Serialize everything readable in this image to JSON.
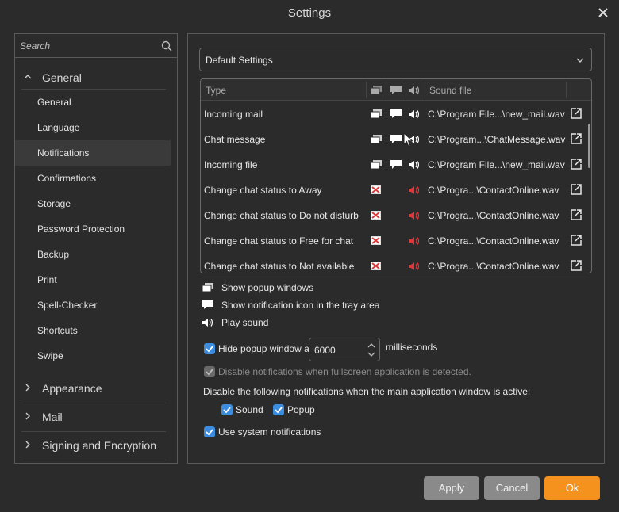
{
  "window": {
    "title": "Settings"
  },
  "search": {
    "placeholder": "Search"
  },
  "sidebar": {
    "general_group": "General",
    "items": [
      "General",
      "Language",
      "Notifications",
      "Confirmations",
      "Storage",
      "Password Protection",
      "Backup",
      "Print",
      "Spell-Checker",
      "Shortcuts",
      "Swipe"
    ],
    "active_item": "Notifications",
    "other_groups": [
      "Appearance",
      "Mail",
      "Signing and Encryption"
    ]
  },
  "profile": {
    "selected": "Default Settings"
  },
  "table": {
    "headers": {
      "type": "Type",
      "sound_file": "Sound file"
    },
    "rows": [
      {
        "type": "Incoming mail",
        "file": "C:\\Program File...\\new_mail.wav",
        "enabled": true
      },
      {
        "type": "Chat message",
        "file": "C:\\Program...\\ChatMessage.wav",
        "enabled": true
      },
      {
        "type": "Incoming file",
        "file": "C:\\Program File...\\new_mail.wav",
        "enabled": true
      },
      {
        "type": "Change chat status to Away",
        "file": "C:\\Progra...\\ContactOnline.wav",
        "enabled": false
      },
      {
        "type": "Change chat status to Do not disturb",
        "file": "C:\\Progra...\\ContactOnline.wav",
        "enabled": false
      },
      {
        "type": "Change chat status to Free for chat",
        "file": "C:\\Progra...\\ContactOnline.wav",
        "enabled": false
      },
      {
        "type": "Change chat status to Not available",
        "file": "C:\\Progra...\\ContactOnline.wav",
        "enabled": false
      }
    ]
  },
  "legend": {
    "popup": "Show popup windows",
    "tray": "Show notification icon in the tray area",
    "sound": "Play sound"
  },
  "options": {
    "hide_popup_label": "Hide popup window after",
    "hide_popup_value": "6000",
    "hide_popup_unit": "milliseconds",
    "fullscreen_label": "Disable notifications when fullscreen application is detected.",
    "active_window_label": "Disable the following notifications when the main application window is active:",
    "sound_label": "Sound",
    "popup_label": "Popup",
    "system_label": "Use system notifications"
  },
  "buttons": {
    "apply": "Apply",
    "cancel": "Cancel",
    "ok": "Ok"
  },
  "colors": {
    "accent": "#3c8ce0",
    "ok": "#f5921e",
    "disabled_red": "#e0383b"
  }
}
